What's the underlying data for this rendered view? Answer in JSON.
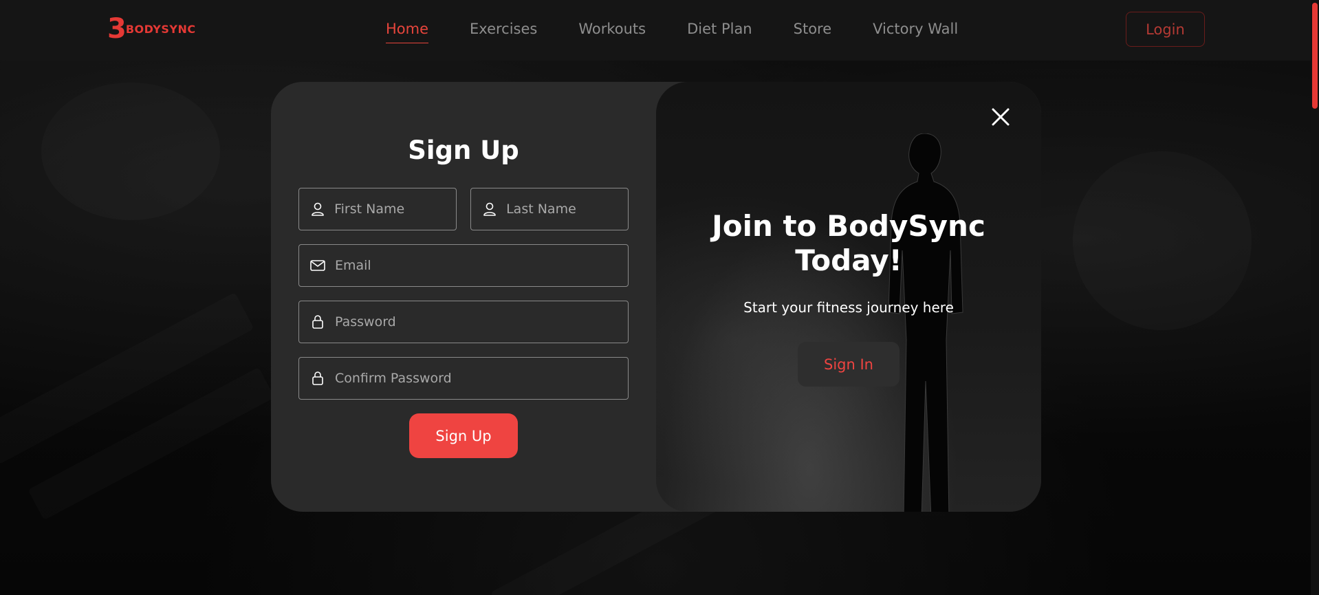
{
  "brand": {
    "mark": "3",
    "name": "BODYSYNC",
    "accent_color": "#e8453c"
  },
  "nav": {
    "items": [
      {
        "label": "Home",
        "active": true
      },
      {
        "label": "Exercises",
        "active": false
      },
      {
        "label": "Workouts",
        "active": false
      },
      {
        "label": "Diet Plan",
        "active": false
      },
      {
        "label": "Store",
        "active": false
      },
      {
        "label": "Victory Wall",
        "active": false
      }
    ],
    "login_label": "Login"
  },
  "signup_form": {
    "title": "Sign Up",
    "fields": {
      "first_name": {
        "placeholder": "First Name",
        "value": "",
        "icon": "user-icon"
      },
      "last_name": {
        "placeholder": "Last Name",
        "value": "",
        "icon": "user-icon"
      },
      "email": {
        "placeholder": "Email",
        "value": "",
        "icon": "mail-icon"
      },
      "password": {
        "placeholder": "Password",
        "value": "",
        "icon": "lock-icon"
      },
      "confirm_password": {
        "placeholder": "Confirm Password",
        "value": "",
        "icon": "lock-icon"
      }
    },
    "submit_label": "Sign Up",
    "submit_color": "#ef4441"
  },
  "promo": {
    "title": "Join to BodySync Today!",
    "subtitle": "Start your fitness journey here",
    "signin_label": "Sign In",
    "close_icon": "close-icon"
  }
}
